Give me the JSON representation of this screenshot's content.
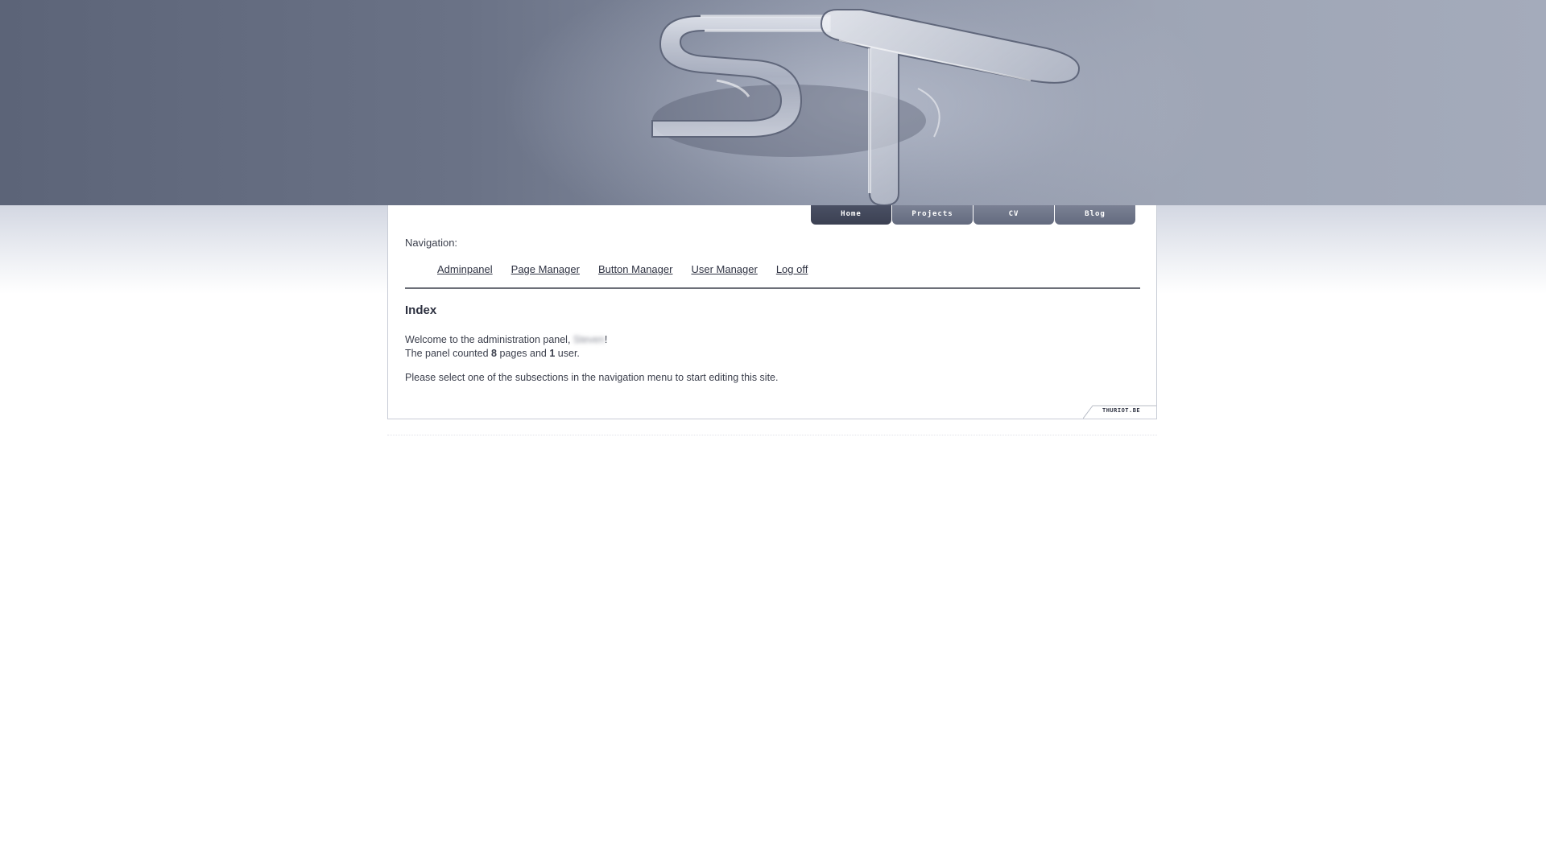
{
  "header": {
    "tabs": [
      {
        "label": "Home",
        "active": true
      },
      {
        "label": "Projects",
        "active": false
      },
      {
        "label": "CV",
        "active": false
      },
      {
        "label": "Blog",
        "active": false
      }
    ]
  },
  "navigation": {
    "title": "Navigation:",
    "links": [
      {
        "label": "Adminpanel"
      },
      {
        "label": "Page Manager"
      },
      {
        "label": "Button Manager"
      },
      {
        "label": "User Manager"
      },
      {
        "label": "Log off"
      }
    ]
  },
  "content": {
    "heading": "Index",
    "welcome_prefix": "Welcome to the administration panel,",
    "user_name": "Steven",
    "welcome_suffix": "!",
    "counted_prefix": "The panel counted",
    "pages_count": "8",
    "pages_word": "pages and",
    "users_count": "1",
    "users_word": "user.",
    "instruction": "Please select one of the subsections in the navigation menu to start editing this site."
  },
  "footer": {
    "badge": "THURIOT.BE"
  },
  "colors": {
    "banner": "#6a7286",
    "tab": "#6b7185",
    "tab_active": "#434859",
    "text": "#3b3f4c"
  }
}
